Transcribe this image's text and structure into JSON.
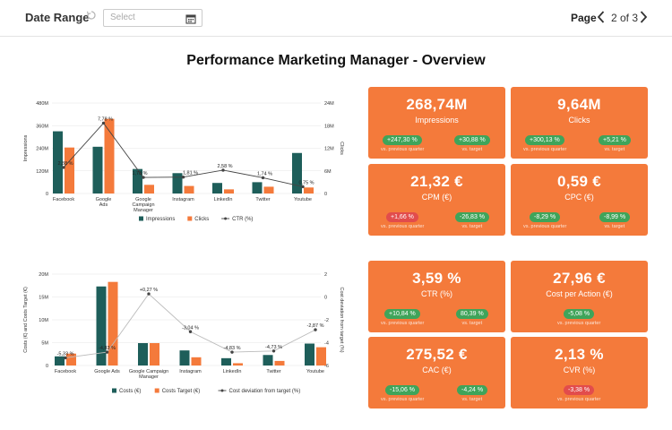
{
  "header": {
    "date_range_label": "Date Range",
    "date_placeholder": "Select",
    "page_label": "Page",
    "page_indicator": "2 of 3"
  },
  "icons": {
    "reset": "reset-icon",
    "calendar": "calendar-icon",
    "prev": "chevron-left-icon",
    "next": "chevron-right-icon"
  },
  "title": "Performance Marketing Manager - Overview",
  "colors": {
    "teal": "#1e5e5a",
    "orange": "#f47a3b",
    "line": "#555555",
    "card": "#f47a3b",
    "positive": "#3fa45a",
    "negative": "#e24c4c"
  },
  "chart_data": [
    {
      "type": "bar",
      "categories": [
        "Facebook",
        "Google Ads",
        "Google Campaign Manager",
        "Instagram",
        "LinkedIn",
        "Twitter",
        "Youtube"
      ],
      "category_display": [
        [
          "Facebook"
        ],
        [
          "Google",
          "Ads"
        ],
        [
          "Google",
          "Campaign",
          "Manager"
        ],
        [
          "Instagram"
        ],
        [
          "LinkedIn"
        ],
        [
          "Twitter"
        ],
        [
          "Youtube"
        ]
      ],
      "series": [
        {
          "name": "Impressions",
          "axis": "left",
          "kind": "bar",
          "values": [
            330,
            248,
            130,
            108,
            56,
            60,
            215
          ]
        },
        {
          "name": "Clicks",
          "axis": "right",
          "kind": "bar",
          "values": [
            12.2,
            19.8,
            2.3,
            2.0,
            1.1,
            1.8,
            1.6
          ]
        },
        {
          "name": "CTR (%)",
          "axis": "line",
          "kind": "line",
          "values": [
            2.88,
            7.78,
            1.78,
            1.81,
            2.58,
            1.74,
            0.75
          ],
          "labels": [
            "2,88 %",
            "7,78 %",
            "1,78 %",
            "1,81 %",
            "2,58 %",
            "1,74 %",
            "0,75 %"
          ]
        }
      ],
      "left_axis": {
        "label": "Impressions",
        "ticks": [
          "0",
          "120M",
          "240M",
          "360M",
          "480M"
        ],
        "max": 480
      },
      "right_axis": {
        "label": "Clicks",
        "ticks": [
          "0",
          "6M",
          "12M",
          "18M",
          "24M"
        ],
        "max": 24
      },
      "line_range": [
        0,
        10
      ],
      "legend": [
        "Impressions",
        "Clicks",
        "CTR (%)"
      ],
      "grid": true
    },
    {
      "type": "bar",
      "categories": [
        "Facebook",
        "Google Ads",
        "Google Campaign Manager",
        "Instagram",
        "LinkedIn",
        "Twitter",
        "Youtube"
      ],
      "category_display": [
        [
          "Facebook"
        ],
        [
          "Google Ads"
        ],
        [
          "Google Campaign",
          "Manager"
        ],
        [
          "Instagram"
        ],
        [
          "LinkedIn"
        ],
        [
          "Twitter"
        ],
        [
          "Youtube"
        ]
      ],
      "series": [
        {
          "name": "Costs (€)",
          "axis": "left",
          "kind": "bar",
          "values": [
            2.0,
            17.3,
            4.9,
            3.3,
            1.6,
            2.3,
            4.8
          ]
        },
        {
          "name": "Costs Target (€)",
          "axis": "left",
          "kind": "bar",
          "values": [
            2.6,
            18.3,
            4.9,
            1.8,
            0.5,
            1.0,
            4.0
          ]
        },
        {
          "name": "Cost deviation from target (%)",
          "axis": "right",
          "kind": "line",
          "values": [
            -5.33,
            -4.83,
            0.27,
            -3.04,
            -4.83,
            -4.73,
            -2.87
          ],
          "labels": [
            "-5,33 %",
            "-4,83 %",
            "+0,27 %",
            "-3,04 %",
            "-4,83 %",
            "-4,73 %",
            "-2,87 %"
          ]
        }
      ],
      "left_axis": {
        "label": "Costs (€) and Costs Target (€)",
        "ticks": [
          "0",
          "5M",
          "10M",
          "15M",
          "20M"
        ],
        "max": 20
      },
      "right_axis": {
        "label": "Cost deviation from target (%)",
        "ticks": [
          "-6",
          "-4",
          "-2",
          "0",
          "2"
        ],
        "min": -6,
        "max": 2
      },
      "legend": [
        "Costs (€)",
        "Costs Target (€)",
        "Cost deviation from target (%)"
      ],
      "grid": true
    }
  ],
  "kpis": [
    {
      "value": "268,74M",
      "name": "Impressions",
      "badges": [
        {
          "text": "+247,30 %",
          "sub": "vs. previous quarter",
          "tone": "pos"
        },
        {
          "text": "+30,88 %",
          "sub": "vs. target",
          "tone": "pos"
        }
      ]
    },
    {
      "value": "9,64M",
      "name": "Clicks",
      "badges": [
        {
          "text": "+300,13 %",
          "sub": "vs. previous quarter",
          "tone": "pos"
        },
        {
          "text": "+5,21 %",
          "sub": "vs. target",
          "tone": "pos"
        }
      ]
    },
    {
      "value": "21,32 €",
      "name": "CPM (€)",
      "badges": [
        {
          "text": "+1,66 %",
          "sub": "vs. previous quarter",
          "tone": "neg"
        },
        {
          "text": "-26,83 %",
          "sub": "vs. target",
          "tone": "pos"
        }
      ]
    },
    {
      "value": "0,59 €",
      "name": "CPC (€)",
      "badges": [
        {
          "text": "-8,29 %",
          "sub": "vs. previous quarter",
          "tone": "pos"
        },
        {
          "text": "-8,99 %",
          "sub": "vs. target",
          "tone": "pos"
        }
      ]
    },
    {
      "value": "3,59 %",
      "name": "CTR (%)",
      "badges": [
        {
          "text": "+10,84 %",
          "sub": "vs. previous quarter",
          "tone": "pos"
        },
        {
          "text": "80,39 %",
          "sub": "vs. target",
          "tone": "pos"
        }
      ]
    },
    {
      "value": "27,96 €",
      "name": "Cost per Action (€)",
      "badges": [
        {
          "text": "-5,08 %",
          "sub": "vs. previous quarter",
          "tone": "pos"
        }
      ]
    },
    {
      "value": "275,52 €",
      "name": "CAC (€)",
      "badges": [
        {
          "text": "-15,06 %",
          "sub": "vs. previous quarter",
          "tone": "pos"
        },
        {
          "text": "-4,24 %",
          "sub": "vs. target",
          "tone": "pos"
        }
      ]
    },
    {
      "value": "2,13 %",
      "name": "CVR (%)",
      "badges": [
        {
          "text": "-3,38 %",
          "sub": "vs. previous quarter",
          "tone": "neg"
        }
      ]
    }
  ]
}
